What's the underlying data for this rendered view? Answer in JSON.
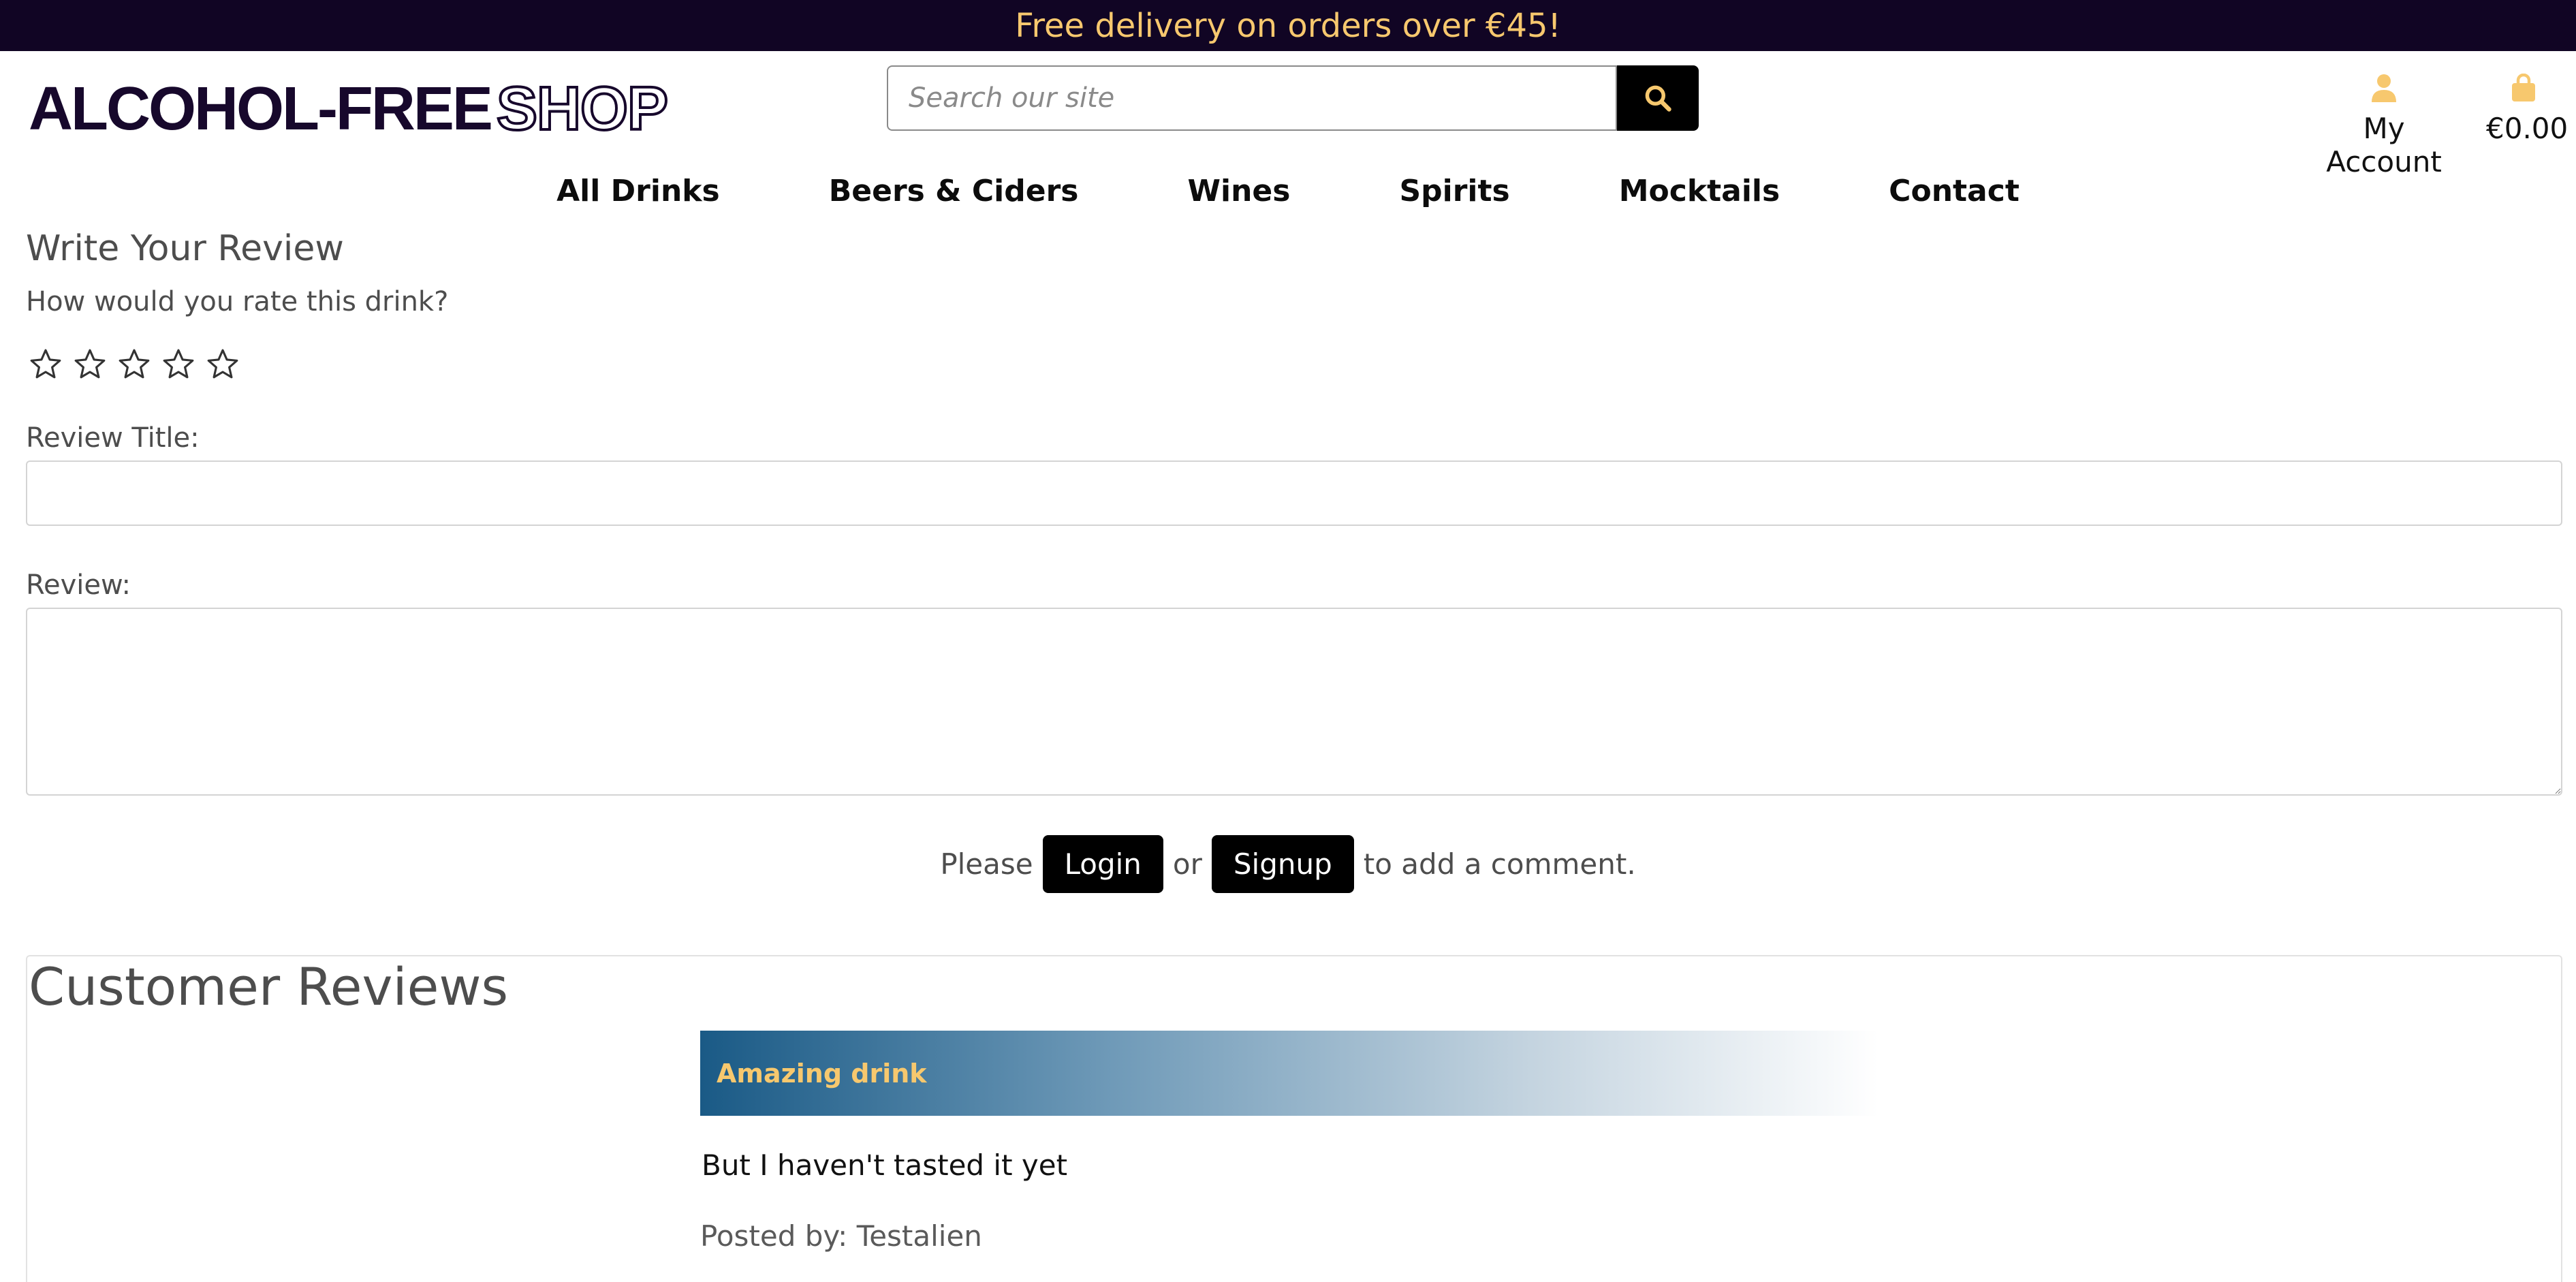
{
  "promo": {
    "text": "Free delivery on orders over €45!"
  },
  "logo": {
    "part1": "ALCOHOL-FREE",
    "part2": "SHOP"
  },
  "search": {
    "placeholder": "Search our site",
    "icon": "search-icon"
  },
  "account": {
    "label": "My Account",
    "icon": "user-icon"
  },
  "cart": {
    "total": "€0.00",
    "icon": "shopping-bag-icon"
  },
  "nav": {
    "items": [
      "All Drinks",
      "Beers & Ciders",
      "Wines",
      "Spirits",
      "Mocktails",
      "Contact"
    ]
  },
  "review_form": {
    "heading": "Write Your Review",
    "rating_question": "How would you rate this drink?",
    "rating": 0,
    "rating_max": 5,
    "title_label": "Review Title:",
    "review_label": "Review:",
    "title_value": "",
    "review_value": ""
  },
  "auth_prompt": {
    "prefix": "Please",
    "login": "Login",
    "or": "or",
    "signup": "Signup",
    "suffix": "to add a comment."
  },
  "reviews": {
    "heading": "Customer Reviews",
    "items": [
      {
        "title": "Amazing drink",
        "body": "But I haven't tasted it yet",
        "posted_by": "Posted by: Testalien"
      }
    ]
  },
  "colors": {
    "promo_bg": "#110524",
    "accent": "#f7c86e",
    "button": "#000000",
    "review_header": "#1a5a86"
  }
}
